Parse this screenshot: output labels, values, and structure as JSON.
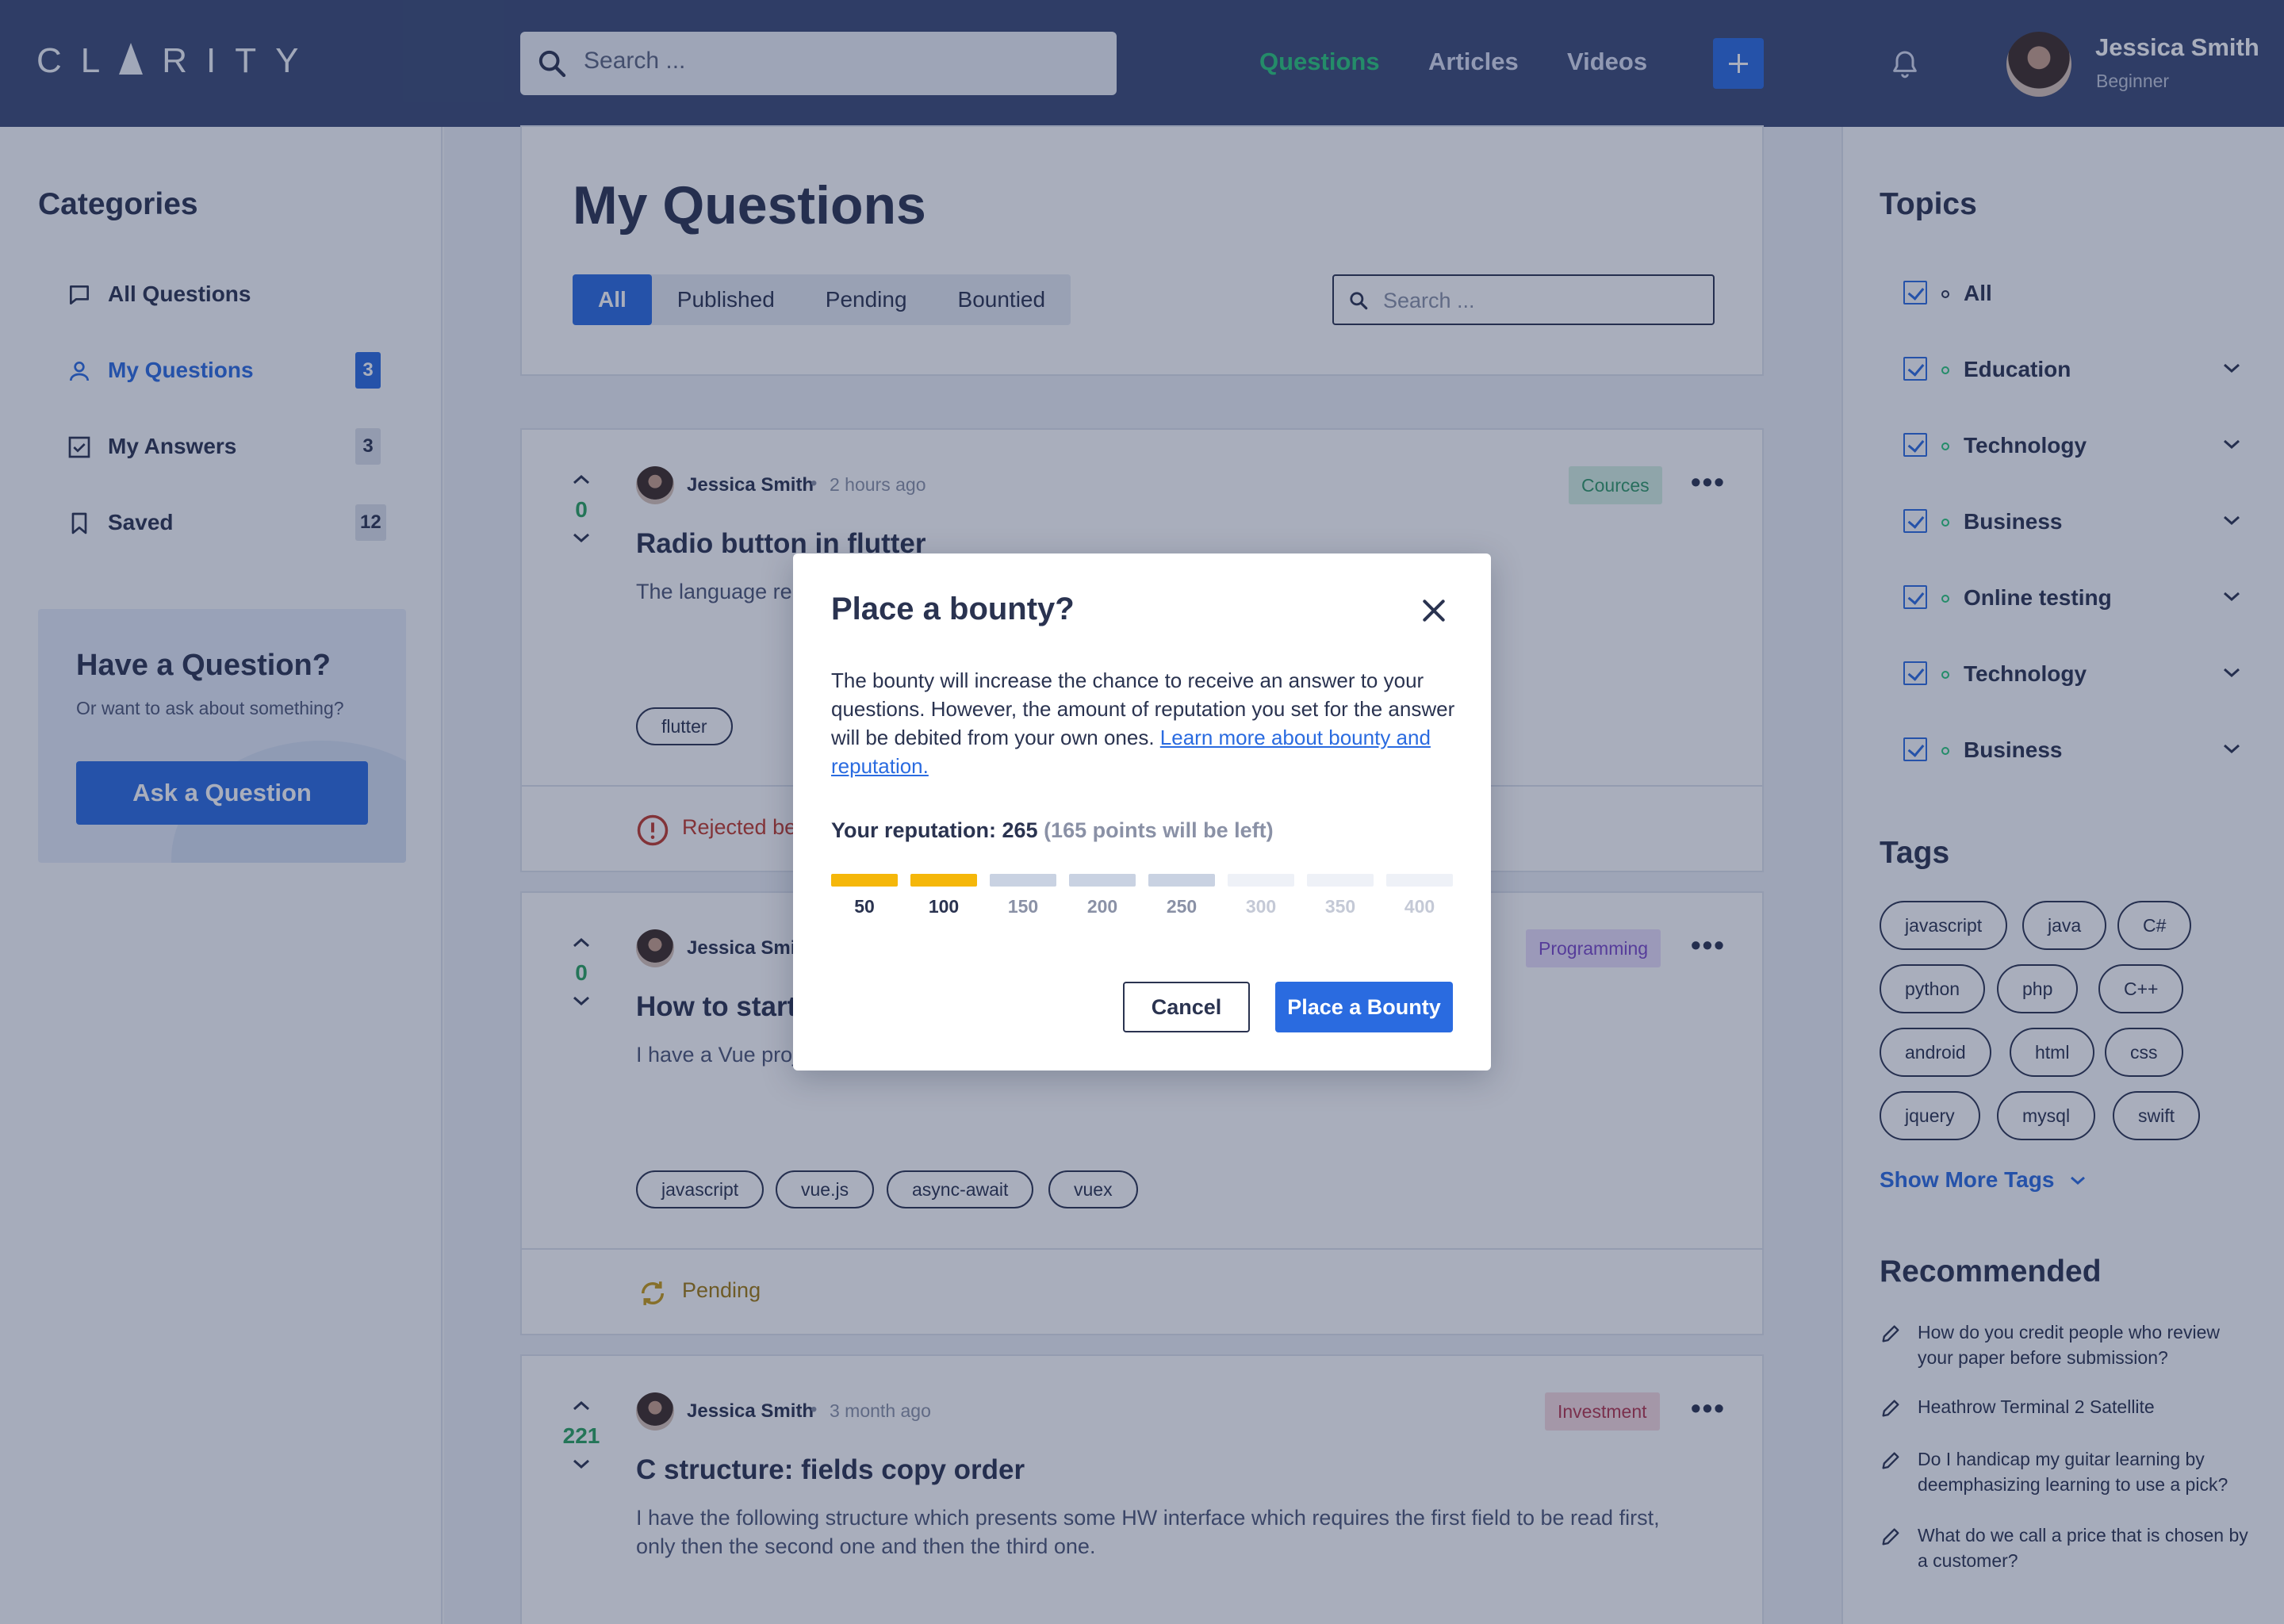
{
  "app": {
    "logo": "CLARITY",
    "search_placeholder": "Search ...",
    "nav": {
      "questions": "Questions",
      "articles": "Articles",
      "videos": "Videos"
    },
    "user": {
      "name": "Jessica Smith",
      "role": "Beginner"
    },
    "colors": {
      "accent": "#2a6be0",
      "header": "#3a4a74",
      "active_nav": "#29c97a"
    }
  },
  "left": {
    "heading": "Categories",
    "items": [
      {
        "label": "All Questions",
        "count": ""
      },
      {
        "label": "My Questions",
        "count": "3"
      },
      {
        "label": "My Answers",
        "count": "3"
      },
      {
        "label": "Saved",
        "count": "12"
      }
    ],
    "ask": {
      "title": "Have a Question?",
      "subtitle": "Or want to ask about something?",
      "button": "Ask a Question"
    }
  },
  "main": {
    "title": "My Questions",
    "tabs": [
      "All",
      "Published",
      "Pending",
      "Bountied"
    ],
    "search_placeholder": "Search ...",
    "questions": [
      {
        "votes": "0",
        "author": "Jessica Smith",
        "time": "2 hours ago",
        "category": "Cources",
        "title": "Radio button in flutter",
        "body": "The language rel… io button. It does, but enter image desc…",
        "tags": [
          "flutter"
        ],
        "status": "Rejected be…"
      },
      {
        "votes": "0",
        "author": "Jessica Smith",
        "time": "",
        "category": "Programming",
        "title": "How to start",
        "body": "I have a Vue proje…",
        "tags": [
          "javascript",
          "vue.js",
          "async-await",
          "vuex"
        ],
        "status": "Pending"
      },
      {
        "votes": "221",
        "author": "Jessica Smith",
        "time": "3 month ago",
        "category": "Investment",
        "title": "C structure: fields copy order",
        "body": "I have the following structure which presents some HW interface which requires the first field to be read first, only then the second one and then the third one.",
        "tags": [],
        "status": ""
      }
    ]
  },
  "right": {
    "topics_heading": "Topics",
    "topics": [
      "All",
      "Education",
      "Technology",
      "Business",
      "Online testing",
      "Technology",
      "Business"
    ],
    "tags_heading": "Tags",
    "tags": [
      "javascript",
      "java",
      "C#",
      "python",
      "php",
      "C++",
      "android",
      "html",
      "css",
      "jquery",
      "mysql",
      "swift"
    ],
    "show_more": "Show More Tags",
    "recommended_heading": "Recommended",
    "recommended": [
      "How do you credit people who review your paper before submission?",
      "Heathrow Terminal 2 Satellite",
      "Do I handicap my guitar learning by deemphasizing learning to use a pick?",
      "What do we call a price that is chosen by a customer?"
    ]
  },
  "modal": {
    "title": "Place a bounty?",
    "text": "The bounty will increase the chance to receive an answer to your questions. However, the amount of reputation you set for the answer will be debited from your own ones. ",
    "link": "Learn more about bounty and reputation.",
    "reputation_label": "Your reputation: 265",
    "reputation_note": "(165 points will be left)",
    "levels": [
      "50",
      "100",
      "150",
      "200",
      "250",
      "300",
      "350",
      "400"
    ],
    "selected_count": 2,
    "cancel": "Cancel",
    "confirm": "Place a Bounty",
    "colors": {
      "selected": "#f5b70a",
      "available": "#c9d2e2",
      "unavailable": "#eef1f7"
    }
  }
}
